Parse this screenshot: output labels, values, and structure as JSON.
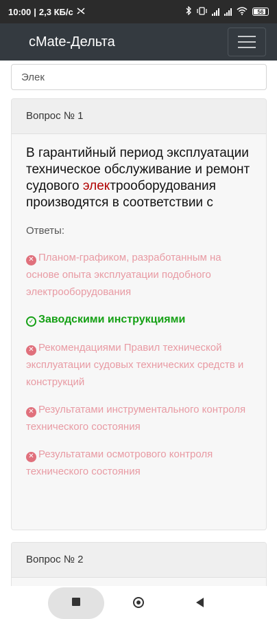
{
  "status_bar": {
    "time": "10:00",
    "speed": "2,3 КБ/с",
    "battery": "56"
  },
  "navbar": {
    "brand": "cMate-Дельта"
  },
  "search": {
    "value": "Элек"
  },
  "questions": [
    {
      "header": "Вопрос № 1",
      "text_before": "В гарантийный период эксплуатации техническое обслуживание и ремонт судового ",
      "text_highlight": "элек",
      "text_after": "трооборудования производятся в соответствии с",
      "answers_label": "Ответы:",
      "answers": [
        {
          "text": "Планом-графиком, разработанным на основе опыта эксплуатации подобного электрооборудования",
          "correct": false
        },
        {
          "text": "Заводскими инструкциями",
          "correct": true
        },
        {
          "text": "Рекомендациями Правил технической эксплуатации судовых технических средств и конструкций",
          "correct": false
        },
        {
          "text": "Результатами инструментального контроля технического состояния",
          "correct": false
        },
        {
          "text": "Результатами осмотрового контроля технического состояния",
          "correct": false
        }
      ]
    },
    {
      "header": "Вопрос № 2"
    }
  ],
  "colors": {
    "navbar": "#343a40",
    "correct": "#14a014",
    "wrong": "#e89aa3",
    "highlight": "#b00000"
  }
}
